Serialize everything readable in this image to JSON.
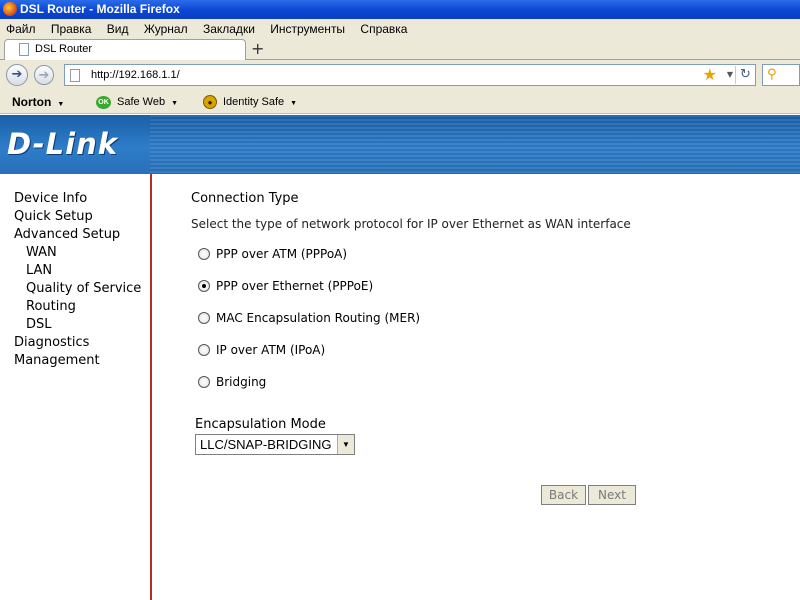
{
  "window": {
    "title": "DSL Router - Mozilla Firefox"
  },
  "menu": [
    "Файл",
    "Правка",
    "Вид",
    "Журнал",
    "Закладки",
    "Инструменты",
    "Справка"
  ],
  "tab": {
    "title": "DSL Router",
    "new_tab_symbol": "+"
  },
  "nav": {
    "url": "http://192.168.1.1/"
  },
  "norton": {
    "brand": "Norton",
    "safe_web": "Safe Web",
    "safe_web_badge": "OK",
    "identity_safe": "Identity Safe"
  },
  "banner": {
    "logo": "D-Link"
  },
  "sidebar": {
    "items": [
      "Device Info",
      "Quick Setup",
      "Advanced Setup",
      "WAN",
      "LAN",
      "Quality of Service",
      "Routing",
      "DSL",
      "Diagnostics",
      "Management"
    ]
  },
  "content": {
    "heading": "Connection Type",
    "description": "Select the type of network protocol for IP over Ethernet as WAN interface",
    "options": [
      {
        "label": "PPP over ATM (PPPoA)",
        "checked": false
      },
      {
        "label": "PPP over Ethernet (PPPoE)",
        "checked": true
      },
      {
        "label": "MAC Encapsulation Routing (MER)",
        "checked": false
      },
      {
        "label": "IP over ATM (IPoA)",
        "checked": false
      },
      {
        "label": "Bridging",
        "checked": false
      }
    ],
    "encapsulation_label": "Encapsulation Mode",
    "encapsulation_value": "LLC/SNAP-BRIDGING",
    "back_label": "Back",
    "next_label": "Next"
  },
  "colors": {
    "banner": "#2e7dc9",
    "sidebar_border": "#b22d2d",
    "titlebar": "#0a46d2"
  }
}
